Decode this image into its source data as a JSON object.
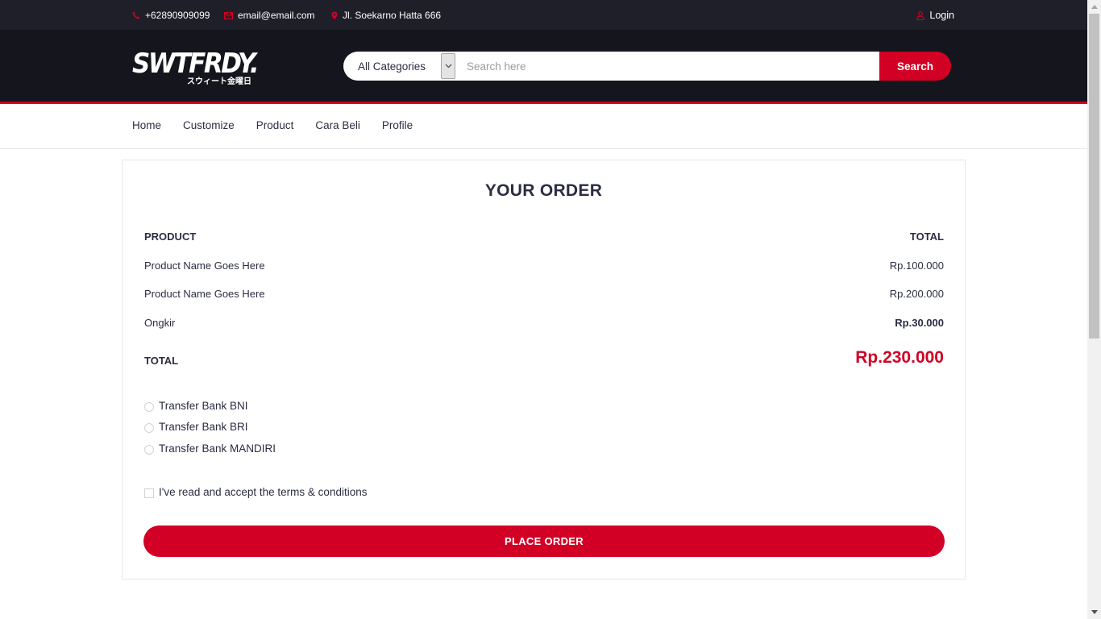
{
  "topbar": {
    "phone": "+62890909099",
    "email": "email@email.com",
    "address": "Jl. Soekarno Hatta 666",
    "login": "Login"
  },
  "header": {
    "logo_text": "SWTFRDY.",
    "logo_sub": "スウィート金曜日",
    "category_selected": "All Categories",
    "search_placeholder": "Search here",
    "search_button": "Search"
  },
  "nav": {
    "items": [
      "Home",
      "Customize",
      "Product",
      "Cara Beli",
      "Profile"
    ]
  },
  "order": {
    "title": "YOUR ORDER",
    "col_product": "PRODUCT",
    "col_total": "TOTAL",
    "items": [
      {
        "name": "Product Name Goes Here",
        "price": "Rp.100.000"
      },
      {
        "name": "Product Name Goes Here",
        "price": "Rp.200.000"
      }
    ],
    "shipping_label": "Ongkir",
    "shipping_price": "Rp.30.000",
    "total_label": "TOTAL",
    "total_price": "Rp.230.000",
    "payment_methods": [
      "Transfer Bank BNI",
      "Transfer Bank BRI",
      "Transfer Bank MANDIRI"
    ],
    "terms": "I've read and accept the terms & conditions",
    "place_order": "PLACE ORDER"
  },
  "colors": {
    "accent": "#d10024",
    "dark": "#15161d",
    "topbar": "#1e1f29",
    "text": "#2b2d42"
  }
}
